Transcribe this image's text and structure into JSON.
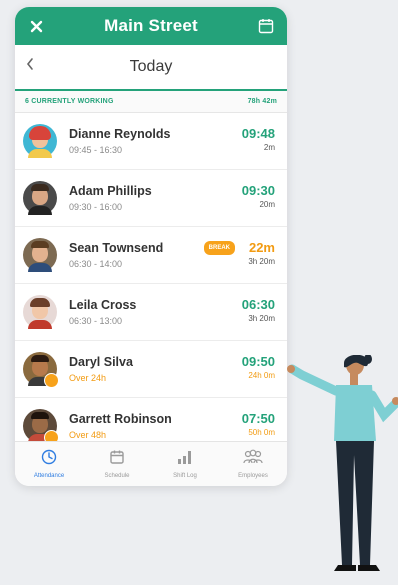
{
  "header": {
    "title": "Main Street",
    "close_icon": "close-icon",
    "calendar_icon": "calendar-icon"
  },
  "daybar": {
    "label": "Today",
    "back_icon": "chevron-left-icon"
  },
  "summary": {
    "working_label": "6 CURRENTLY WORKING",
    "total": "78h 42m"
  },
  "employees": [
    {
      "name": "Dianne Reynolds",
      "sub": "09:45 - 16:30",
      "time": "09:48",
      "small": "2m",
      "warn": false,
      "onbreak": false
    },
    {
      "name": "Adam Phillips",
      "sub": "09:30 - 16:00",
      "time": "09:30",
      "small": "20m",
      "warn": false,
      "onbreak": false
    },
    {
      "name": "Sean Townsend",
      "sub": "06:30 - 14:00",
      "time": "22m",
      "small": "3h 20m",
      "warn": false,
      "onbreak": true,
      "break_label": "BREAK"
    },
    {
      "name": "Leila Cross",
      "sub": "06:30 - 13:00",
      "time": "06:30",
      "small": "3h 20m",
      "warn": false,
      "onbreak": false
    },
    {
      "name": "Daryl Silva",
      "sub": "Over 24h",
      "time": "09:50",
      "small": "24h 0m",
      "warn": true,
      "onbreak": false
    },
    {
      "name": "Garrett Robinson",
      "sub": "Over 48h",
      "time": "07:50",
      "small": "50h 0m",
      "warn": true,
      "onbreak": false
    }
  ],
  "tabs": [
    {
      "label": "Attendance",
      "icon": "clock-icon",
      "active": true
    },
    {
      "label": "Schedule",
      "icon": "calendar-icon",
      "active": false
    },
    {
      "label": "Shift Log",
      "icon": "bar-chart-icon",
      "active": false
    },
    {
      "label": "Employees",
      "icon": "people-icon",
      "active": false
    }
  ],
  "colors": {
    "brand": "#24a27a",
    "warning": "#f7a21b",
    "active_tab": "#2f7de1"
  }
}
